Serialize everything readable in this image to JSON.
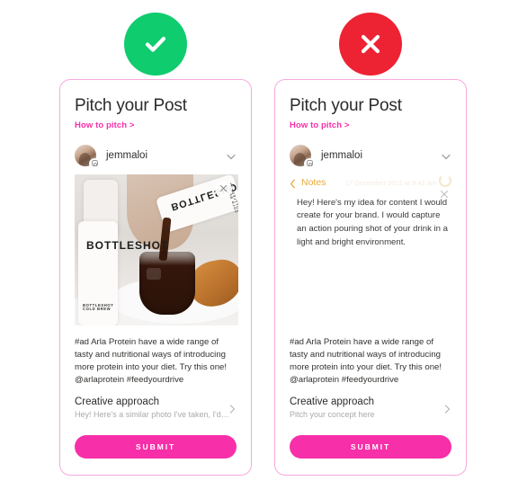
{
  "badges": {
    "approved": {
      "icon": "check-icon",
      "color": "#0fcc6f"
    },
    "rejected": {
      "icon": "cross-icon",
      "color": "#ed2233"
    }
  },
  "theme": {
    "accent_pink": "#f72fa8",
    "card_border": "#f7a9dd",
    "notes_amber": "#e9a93a",
    "page_background": "#ffffff"
  },
  "cards": [
    {
      "title": "Pitch your Post",
      "how_to_link": "How to pitch >",
      "account": {
        "username": "jemmaloi",
        "platform_icon": "instagram-icon",
        "expand_icon": "chevron-down-icon"
      },
      "media": {
        "type": "photo",
        "alt": "Bottleshot cold brew poured into a glass of ice beside a croissant",
        "remove_icon": "close-icon"
      },
      "caption": "#ad Arla Protein have a wide range of tasty and nutritional ways of introducing more protein into your diet. Try this one! @arlaprotein #feedyourdrive",
      "approach": {
        "title": "Creative approach",
        "subtitle": "Hey! Here's a similar photo I've taken, I'd…",
        "chevron_icon": "chevron-right-icon"
      },
      "submit_label": "SUBMIT"
    },
    {
      "title": "Pitch your Post",
      "how_to_link": "How to pitch >",
      "account": {
        "username": "jemmaloi",
        "platform_icon": "instagram-icon",
        "expand_icon": "chevron-down-icon"
      },
      "notes": {
        "back_icon": "chevron-left-icon",
        "label": "Notes",
        "timestamp": "17 December 2021 at 9:41 am",
        "spinner_icon": "loading-spinner-icon",
        "close_icon": "close-icon",
        "body": "Hey! Here's my idea for content I would create for your brand. I would capture an action pouring shot of your drink in a light and bright environment."
      },
      "caption": "#ad Arla Protein have a wide range of tasty and nutritional ways of introducing more protein into your diet. Try this one! @arlaprotein #feedyourdrive",
      "approach": {
        "title": "Creative approach",
        "subtitle": "Pitch your concept here",
        "chevron_icon": "chevron-right-icon"
      },
      "submit_label": "SUBMIT"
    }
  ],
  "photo_labels": {
    "bottle_front_brand": "BOTTLESHOT",
    "bottle_front_sub": "BOTTLESHOT COLD BREW",
    "bottle_tilted_brand": "BOTTLESHOT",
    "bottle_tilted_sub": "BOTTLESHOT COLD BREW"
  }
}
